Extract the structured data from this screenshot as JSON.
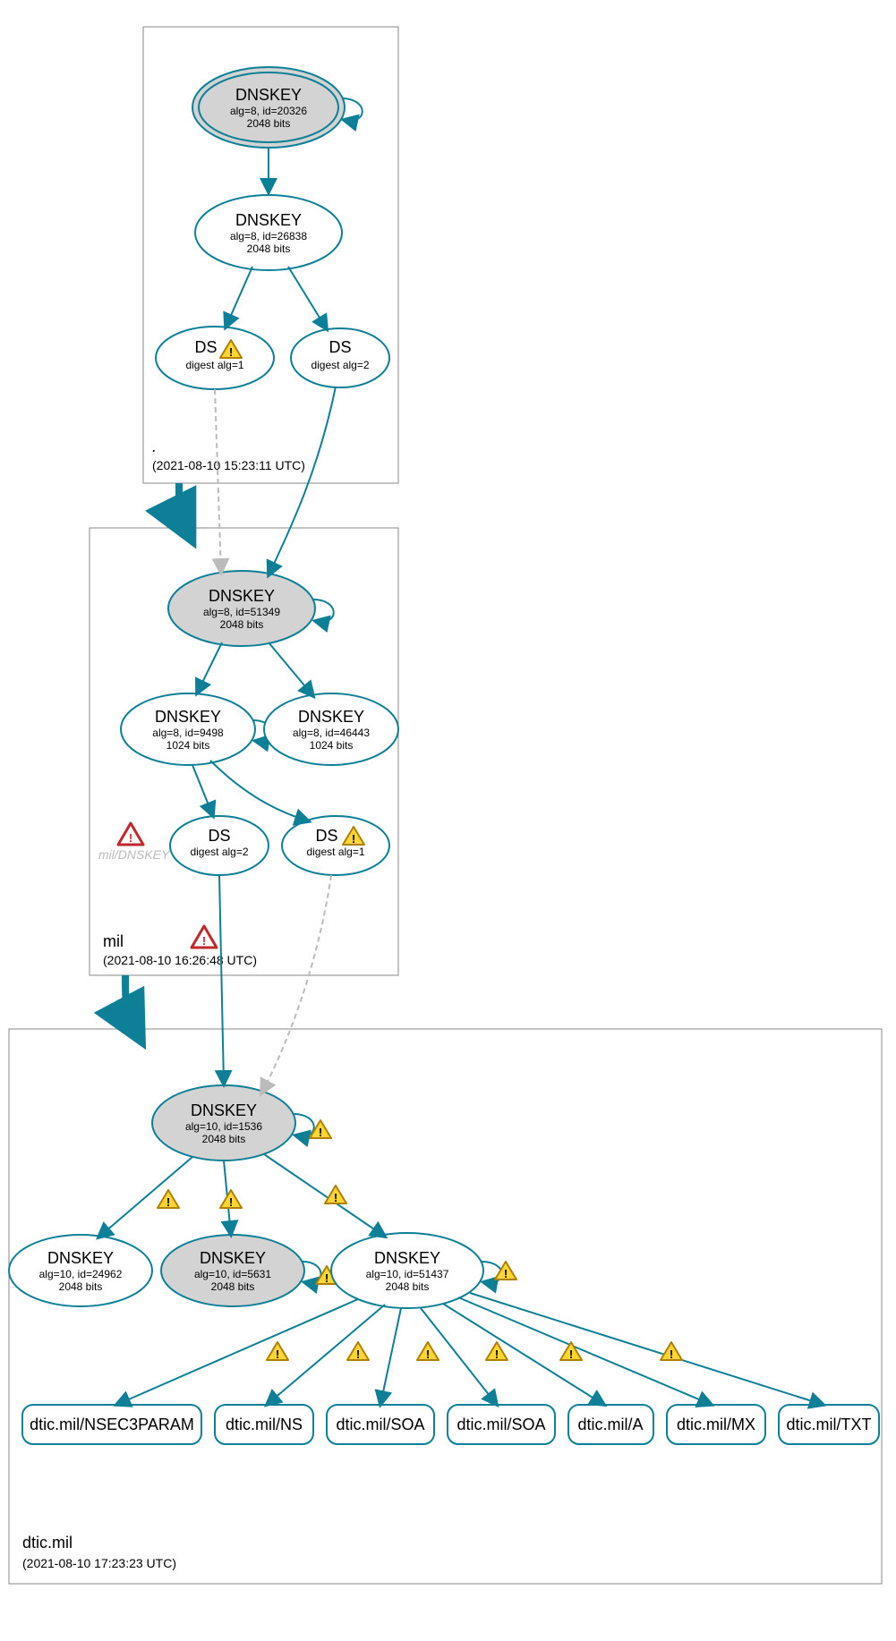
{
  "zones": {
    "root": {
      "label": ".",
      "date": "(2021-08-10 15:23:11 UTC)"
    },
    "mil": {
      "label": "mil",
      "date": "(2021-08-10 16:26:48 UTC)"
    },
    "dtic": {
      "label": "dtic.mil",
      "date": "(2021-08-10 17:23:23 UTC)"
    }
  },
  "nodes": {
    "root_ksk": {
      "title": "DNSKEY",
      "l1": "alg=8, id=20326",
      "l2": "2048 bits"
    },
    "root_zsk": {
      "title": "DNSKEY",
      "l1": "alg=8, id=26838",
      "l2": "2048 bits"
    },
    "root_ds1": {
      "title": "DS",
      "l1": "digest alg=1"
    },
    "root_ds2": {
      "title": "DS",
      "l1": "digest alg=2"
    },
    "mil_ksk": {
      "title": "DNSKEY",
      "l1": "alg=8, id=51349",
      "l2": "2048 bits"
    },
    "mil_zsk1": {
      "title": "DNSKEY",
      "l1": "alg=8, id=9498",
      "l2": "1024 bits"
    },
    "mil_zsk2": {
      "title": "DNSKEY",
      "l1": "alg=8, id=46443",
      "l2": "1024 bits"
    },
    "mil_ds2": {
      "title": "DS",
      "l1": "digest alg=2"
    },
    "mil_ds1": {
      "title": "DS",
      "l1": "digest alg=1"
    },
    "mil_sidelabel": "mil/DNSKEY",
    "dtic_ksk": {
      "title": "DNSKEY",
      "l1": "alg=10, id=1536",
      "l2": "2048 bits"
    },
    "dtic_k1": {
      "title": "DNSKEY",
      "l1": "alg=10, id=24962",
      "l2": "2048 bits"
    },
    "dtic_k2": {
      "title": "DNSKEY",
      "l1": "alg=10, id=5631",
      "l2": "2048 bits"
    },
    "dtic_k3": {
      "title": "DNSKEY",
      "l1": "alg=10, id=51437",
      "l2": "2048 bits"
    }
  },
  "rr": {
    "r0": "dtic.mil/NSEC3PARAM",
    "r1": "dtic.mil/NS",
    "r2": "dtic.mil/SOA",
    "r3": "dtic.mil/SOA",
    "r4": "dtic.mil/A",
    "r5": "dtic.mil/MX",
    "r6": "dtic.mil/TXT"
  }
}
